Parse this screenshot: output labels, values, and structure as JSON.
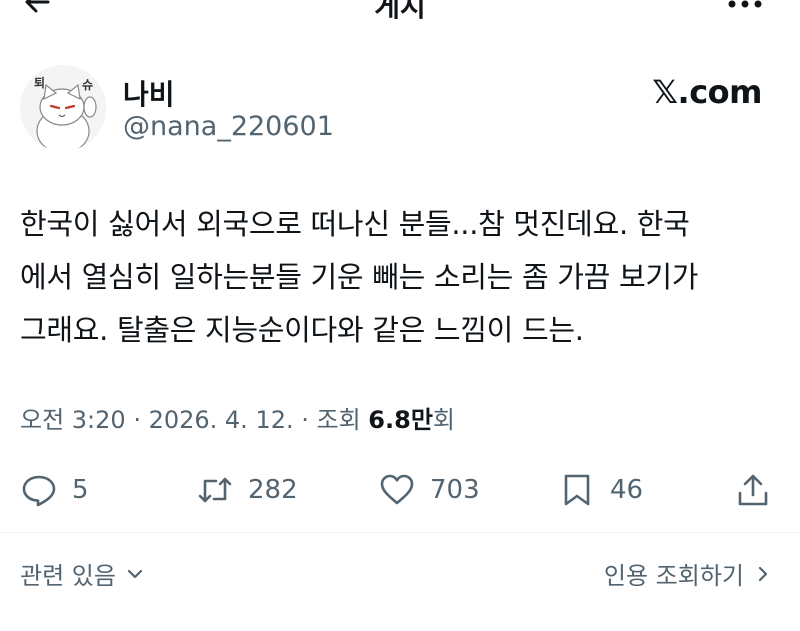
{
  "topbar": {
    "title": "게시",
    "back_icon": "arrow-left-icon",
    "more_icon": "more-dots-icon"
  },
  "author": {
    "display_name": "나비",
    "handle": "@nana_220601",
    "avatar_icon": "cat-avatar",
    "avatar_text": [
      "퇴",
      "슈"
    ],
    "source_label": "𝕏.com"
  },
  "tweet": {
    "lines": [
      "한국이 싫어서 외국으로 떠나신 분들...참 멋진데요. 한국",
      "에서 열심히 일하는분들 기운 빼는 소리는 좀 가끔 보기가",
      "그래요. 탈출은 지능순이다와 같은 느낌이 드는."
    ]
  },
  "meta": {
    "time": "오전 3:20",
    "sep1": " · ",
    "date": "2026. 4. 12.",
    "sep2": " · ",
    "views_label": "조회 ",
    "views_count": "6.8",
    "views_unit": "만",
    "views_suffix": "회"
  },
  "actions": {
    "replies": "5",
    "retweets": "282",
    "likes": "703",
    "bookmarks": "46",
    "icons": [
      "reply-icon",
      "retweet-icon",
      "like-icon",
      "bookmark-icon",
      "share-icon"
    ]
  },
  "footer": {
    "related_label": "관련 있음",
    "quotes_label": "인용 조회하기"
  },
  "colors": {
    "text": "#0f1419",
    "secondary": "#536471",
    "divider": "#eff3f4",
    "background": "#ffffff"
  }
}
